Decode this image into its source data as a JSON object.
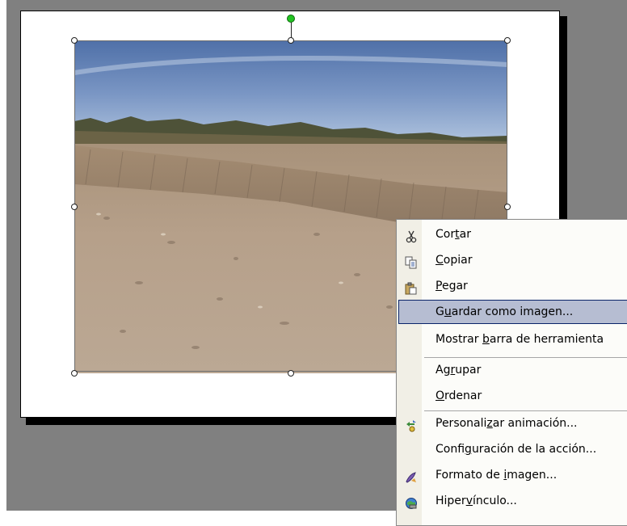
{
  "menu": {
    "items": [
      {
        "id": "cortar",
        "pre": "Cor",
        "ul": "t",
        "post": "ar",
        "icon": "scissors-icon"
      },
      {
        "id": "copiar",
        "pre": "",
        "ul": "C",
        "post": "opiar",
        "icon": "copy-icon"
      },
      {
        "id": "pegar",
        "pre": "",
        "ul": "P",
        "post": "egar",
        "icon": "paste-icon"
      },
      {
        "id": "guardar",
        "pre": "G",
        "ul": "u",
        "post": "ardar como imagen...",
        "highlighted": true
      },
      {
        "id": "mostrar",
        "pre": "Mostrar ",
        "ul": "b",
        "post": "arra de herramienta"
      },
      {
        "id": "agrupar",
        "pre": "Ag",
        "ul": "r",
        "post": "upar"
      },
      {
        "id": "ordenar",
        "pre": "",
        "ul": "O",
        "post": "rdenar"
      },
      {
        "id": "personalizar",
        "pre": "Personali",
        "ul": "z",
        "post": "ar animación...",
        "icon": "animation-icon"
      },
      {
        "id": "configuracion",
        "pre": "Confi",
        "ul": "g",
        "post": "uración de la acción..."
      },
      {
        "id": "formato",
        "pre": "Formato de ",
        "ul": "i",
        "post": "magen...",
        "icon": "format-picture-icon"
      },
      {
        "id": "hipervinculo",
        "pre": "Hiper",
        "ul": "v",
        "post": "ínculo...",
        "icon": "hyperlink-icon"
      }
    ],
    "highlight_color": "#b6bdd2",
    "highlight_border": "#0a246a"
  },
  "slide": {
    "background": "#ffffff",
    "workspace_color": "#808080"
  },
  "selection": {
    "rotate_handle_color": "#22c322"
  }
}
